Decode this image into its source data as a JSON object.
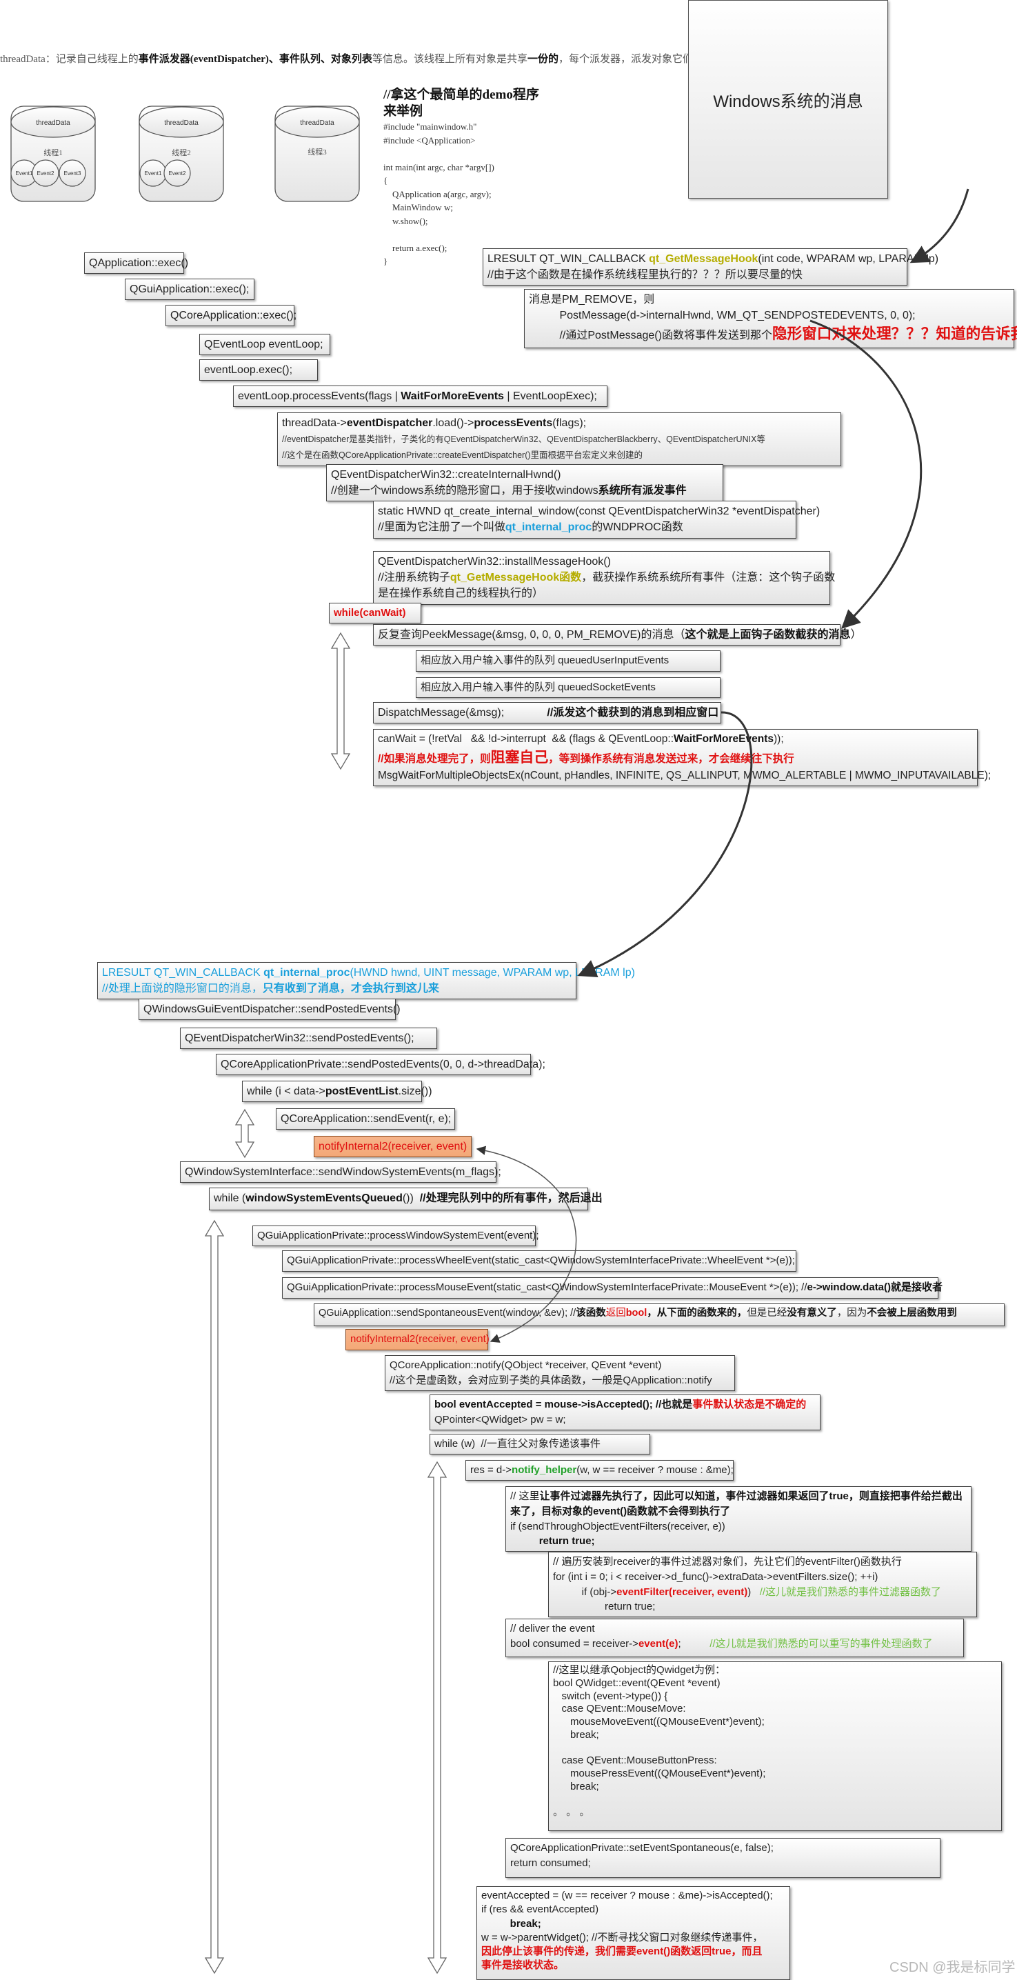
{
  "header": [
    [
      "threadData：记录自己线程上的",
      ""
    ],
    [
      "事件派发器(eventDispatcher)、事件队列、对象列表",
      "b"
    ],
    [
      "等信息。该线程上所有对象是共享",
      ""
    ],
    [
      "一份的",
      "b"
    ],
    [
      "，每个派发器，派发对象它们都有它的指针",
      ""
    ]
  ],
  "threads": [
    {
      "label": "threadData",
      "name": "线程1",
      "events": [
        "Event1",
        "Event2",
        "Event3"
      ]
    },
    {
      "label": "threadData",
      "name": "线程2",
      "events": [
        "Event1",
        "Event2"
      ]
    },
    {
      "label": "threadData",
      "name": "线程3",
      "events": []
    }
  ],
  "demo": {
    "title": "//拿这个最简单的demo程序来举例",
    "code": "#include \"mainwindow.h\"\n#include <QApplication>\n\nint main(int argc, char *argv[])\n{\n    QApplication a(argc, argv);\n    MainWindow w;\n    w.show();\n\n    return a.exec();\n}"
  },
  "windows_box": "Windows系统的消息",
  "boxes": [
    {
      "id": "get-message-hook",
      "lines": [
        [
          [
            "LRESULT QT_WIN_CALLBACK ",
            ""
          ],
          [
            "qt_GetMessageHook",
            "olive"
          ],
          [
            "(int code, WPARAM wp, LPARAM lp)",
            ""
          ]
        ],
        [
          [
            "//由于这个函数是在操作系统线程里执行的？？？所以要尽量的快",
            ""
          ]
        ]
      ]
    },
    {
      "id": "pm-remove",
      "lines": [
        [
          [
            "消息是PM_REMOVE，则",
            ""
          ]
        ],
        [
          [
            "          PostMessage(d->internalHwnd, WM_QT_SENDPOSTEDEVENTS, 0, 0);",
            ""
          ]
        ],
        [
          [
            "          //通过PostMessage()函数将事件发送到那个",
            ""
          ],
          [
            "隐形窗口对来处理？？？知道的告诉我",
            "bigred"
          ]
        ]
      ]
    },
    {
      "id": "qapplication-exec",
      "lines": [
        [
          [
            "QApplication::exec()",
            ""
          ]
        ]
      ]
    },
    {
      "id": "qguiapplication-exec",
      "lines": [
        [
          [
            "QGuiApplication::exec();",
            ""
          ]
        ]
      ]
    },
    {
      "id": "qcoreapplication-exec",
      "lines": [
        [
          [
            "QCoreApplication::exec();",
            ""
          ]
        ]
      ]
    },
    {
      "id": "qeventloop-decl",
      "lines": [
        [
          [
            "QEventLoop eventLoop;",
            ""
          ]
        ]
      ]
    },
    {
      "id": "eventloop-exec",
      "lines": [
        [
          [
            "eventLoop.exec();",
            ""
          ]
        ]
      ]
    },
    {
      "id": "process-events",
      "lines": [
        [
          [
            "eventLoop.processEvents(flags | ",
            ""
          ],
          [
            "WaitForMoreEvents",
            "b"
          ],
          [
            " | EventLoopExec);",
            ""
          ]
        ]
      ]
    },
    {
      "id": "dispatcher-process-events",
      "lines": [
        [
          [
            "threadData->",
            ""
          ],
          [
            "eventDispatcher",
            "b"
          ],
          [
            ".load()->",
            ""
          ],
          [
            "processEvents",
            "b"
          ],
          [
            "(flags);",
            ""
          ]
        ],
        [
          [
            "//eventDispatcher是基类指针，子类化的有QEventDispatcherWin32、QEventDispatcherBlackberry、QEventDispatcherUNIX等",
            "sm"
          ]
        ],
        [
          [
            "//这个是在函数QCoreApplicationPrivate::createEventDispatcher()里面根据平台宏定义来创建的",
            "sm"
          ]
        ]
      ]
    },
    {
      "id": "create-internal-hwnd",
      "lines": [
        [
          [
            "QEventDispatcherWin32::createInternalHwnd()",
            ""
          ]
        ],
        [
          [
            "//创建一个windows系统的隐形窗口，用于接收windows",
            ""
          ],
          [
            "系统所有派发事件",
            "b"
          ]
        ]
      ]
    },
    {
      "id": "create-internal-window",
      "lines": [
        [
          [
            "static HWND qt_create_internal_window(const QEventDispatcherWin32 *eventDispatcher)",
            ""
          ]
        ],
        [
          [
            "//里面为它注册了一个叫做",
            ""
          ],
          [
            "qt_internal_proc",
            "cyanb"
          ],
          [
            "的WNDPROC函数",
            ""
          ]
        ]
      ]
    },
    {
      "id": "install-message-hook",
      "lines": [
        [
          [
            "QEventDispatcherWin32::installMessageHook()",
            ""
          ]
        ],
        [
          [
            "//注册系统钩子",
            ""
          ],
          [
            "qt_GetMessageHook函数",
            "olive"
          ],
          [
            "，截获操作系统系统所有事件（注意：这个钩子函数",
            ""
          ]
        ],
        [
          [
            "是在操作系统自己的线程执行的）",
            ""
          ]
        ]
      ]
    },
    {
      "id": "while-canwait",
      "lines": [
        [
          [
            "while(canWait)",
            "redb"
          ]
        ]
      ]
    },
    {
      "id": "peek-message",
      "lines": [
        [
          [
            "反复查询PeekMessage(&msg, 0, 0, 0, PM_REMOVE)的消息（",
            ""
          ],
          [
            "这个就是上面钩子函数截获的消息",
            "b"
          ],
          [
            "）",
            ""
          ]
        ]
      ]
    },
    {
      "id": "queued-user-input",
      "lines": [
        [
          [
            "相应放入用户输入事件的队列 queuedUserInputEvents",
            ""
          ]
        ]
      ]
    },
    {
      "id": "queued-socket",
      "lines": [
        [
          [
            "相应放入用户输入事件的队列 queuedSocketEvents",
            ""
          ]
        ]
      ]
    },
    {
      "id": "dispatch-message",
      "lines": [
        [
          [
            "DispatchMessage(&msg);              ",
            ""
          ],
          [
            "//派发这个截获到的消息到相应窗口",
            "b"
          ]
        ]
      ]
    },
    {
      "id": "can-wait",
      "lines": [
        [
          [
            "canWait = (!retVal   && !d->interrupt  && (flags & QEventLoop::",
            ""
          ],
          [
            "WaitForMoreEvents",
            "b"
          ],
          [
            "));",
            ""
          ]
        ],
        [
          [
            "//如果消息处理完了，则",
            "redb"
          ],
          [
            "阻塞自己",
            "bigred"
          ],
          [
            "，等到操作系统有消息发送过来，才会继续往下执行",
            "redb"
          ]
        ],
        [
          [
            "MsgWaitForMultipleObjectsEx(nCount, pHandles, INFINITE, QS_ALLINPUT, MWMO_ALERTABLE | MWMO_INPUTAVAILABLE);",
            ""
          ]
        ]
      ]
    },
    {
      "id": "internal-proc",
      "lines": [
        [
          [
            "LRESULT QT_WIN_CALLBACK ",
            "cyan"
          ],
          [
            "qt_internal_proc",
            "cyanb"
          ],
          [
            "(HWND hwnd, UINT message, WPARAM wp, LPARAM lp)",
            "cyan"
          ]
        ],
        [
          [
            "//处理上面说的隐形窗口的消息，",
            "cyan"
          ],
          [
            "只有收到了消息，才会执行到这儿来",
            "cyanb"
          ]
        ]
      ]
    },
    {
      "id": "gui-send-posted",
      "lines": [
        [
          [
            "QWindowsGuiEventDispatcher::sendPostedEvents()",
            ""
          ]
        ]
      ]
    },
    {
      "id": "win32-send-posted",
      "lines": [
        [
          [
            "QEventDispatcherWin32::sendPostedEvents();",
            ""
          ]
        ]
      ]
    },
    {
      "id": "core-send-posted",
      "lines": [
        [
          [
            "QCoreApplicationPrivate::sendPostedEvents(0, 0, d->threadData);",
            ""
          ]
        ]
      ]
    },
    {
      "id": "while-post-event-list",
      "lines": [
        [
          [
            "while (i < data->",
            ""
          ],
          [
            "postEventList",
            "b"
          ],
          [
            ".size())",
            ""
          ]
        ]
      ]
    },
    {
      "id": "send-event",
      "lines": [
        [
          [
            "QCoreApplication::sendEvent(r, e);",
            ""
          ]
        ]
      ]
    },
    {
      "id": "notify-internal2-a",
      "orange": true,
      "lines": [
        [
          [
            "notifyInternal2(receiver, event)",
            "red"
          ]
        ]
      ]
    },
    {
      "id": "send-window-system-events",
      "lines": [
        [
          [
            "QWindowSystemInterface::sendWindowSystemEvents(m_flags);",
            ""
          ]
        ]
      ]
    },
    {
      "id": "while-window-system-events",
      "lines": [
        [
          [
            "while (",
            ""
          ],
          [
            "windowSystemEventsQueued",
            "b"
          ],
          [
            "())  ",
            ""
          ],
          [
            "//处理完队列中的所有事件，然后退出",
            "b"
          ]
        ]
      ]
    },
    {
      "id": "process-window-system-event",
      "lines": [
        [
          [
            "QGuiApplicationPrivate::processWindowSystemEvent(event);",
            ""
          ]
        ]
      ]
    },
    {
      "id": "process-wheel-event",
      "lines": [
        [
          [
            "QGuiApplicationPrivate::processWheelEvent(static_cast<QWindowSystemInterfacePrivate::WheelEvent *>(e));",
            ""
          ]
        ]
      ]
    },
    {
      "id": "process-mouse-event",
      "lines": [
        [
          [
            "QGuiApplicationPrivate::processMouseEvent(static_cast<QWindowSystemInterfacePrivate::MouseEvent *>(e)); //",
            ""
          ],
          [
            "e->window.data()就是接收者",
            "b"
          ]
        ]
      ]
    },
    {
      "id": "send-spontaneous-event",
      "lines": [
        [
          [
            "QGuiApplication::sendSpontaneousEvent(window, &ev); //",
            ""
          ],
          [
            "该函数",
            "b"
          ],
          [
            "返回",
            "red"
          ],
          [
            "bool",
            "redb"
          ],
          [
            "，从下面的函数来的，",
            "b"
          ],
          [
            "但是已经",
            ""
          ],
          [
            "没有意义了",
            "b"
          ],
          [
            "，因为",
            ""
          ],
          [
            "不会被上层函数用到",
            "b"
          ]
        ]
      ]
    },
    {
      "id": "notify-internal2-b",
      "orange": true,
      "lines": [
        [
          [
            "notifyInternal2(receiver, event)",
            "red"
          ]
        ]
      ]
    },
    {
      "id": "core-notify",
      "lines": [
        [
          [
            "QCoreApplication::notify(QObject *receiver, QEvent *event)",
            ""
          ]
        ],
        [
          [
            "//这个是虚函数，会对应到子类的具体函数，一般是QApplication::notify",
            ""
          ]
        ]
      ]
    },
    {
      "id": "event-accepted-init",
      "lines": [
        [
          [
            "bool eventAccepted = mouse->isAccepted(); //也就是",
            "b"
          ],
          [
            "事件默认状态是不确定的",
            "redb"
          ]
        ],
        [
          [
            "QPointer<QWidget> pw = w;",
            ""
          ]
        ]
      ]
    },
    {
      "id": "while-w",
      "lines": [
        [
          [
            "while (w)  //一直往父对象传递该事件",
            ""
          ]
        ]
      ]
    },
    {
      "id": "notify-helper",
      "lines": [
        [
          [
            "res = d->",
            ""
          ],
          [
            "notify_helper",
            "greenb"
          ],
          [
            "(w, w == receiver ? mouse : &me);",
            ""
          ]
        ]
      ]
    },
    {
      "id": "event-filters-comment",
      "wrap": true,
      "lines": [
        [
          [
            "// 这里",
            ""
          ],
          [
            "让事件过滤器先执行了，因此可以知道，事件过滤器如果返回了true，则直接把事件给拦截出来了，目标对象的event()函数就不会得到执行了",
            "b"
          ]
        ],
        [
          [
            "if (sendThroughObjectEventFilters(receiver, e))",
            ""
          ]
        ],
        [
          [
            "          return true;",
            "b"
          ]
        ]
      ]
    },
    {
      "id": "event-filters-loop",
      "lines": [
        [
          [
            "// 遍历安装到receiver的事件过滤器对象们，先让它们的eventFilter()函数执行",
            ""
          ]
        ],
        [
          [
            "for (int i = 0; i < receiver->d_func()->extraData->eventFilters.size(); ++i)",
            ""
          ]
        ],
        [
          [
            "          if (obj->",
            ""
          ],
          [
            "eventFilter(receiver, event)",
            "redb"
          ],
          [
            ")   ",
            ""
          ],
          [
            "//这儿就是我们熟悉的事件过滤器函数了",
            "lgreen"
          ]
        ],
        [
          [
            "                  return true;",
            ""
          ]
        ]
      ]
    },
    {
      "id": "deliver-event",
      "lines": [
        [
          [
            "// deliver the event",
            ""
          ]
        ],
        [
          [
            "bool consumed = receiver->",
            ""
          ],
          [
            "event(e)",
            "redb"
          ],
          [
            ";          ",
            ""
          ],
          [
            "//这儿就是我们熟悉的可以重写的事件处理函数了",
            "lgreen"
          ]
        ]
      ]
    },
    {
      "id": "qwidget-event",
      "lines": [
        [
          [
            "//这里以继承Qobject的Qwidget为例：",
            ""
          ]
        ],
        [
          [
            "bool QWidget::event(QEvent *event)",
            ""
          ]
        ],
        [
          [
            "   switch (event->type()) {",
            ""
          ]
        ],
        [
          [
            "   case QEvent::MouseMove:",
            ""
          ]
        ],
        [
          [
            "      mouseMoveEvent((QMouseEvent*)event);",
            ""
          ]
        ],
        [
          [
            "      break;",
            ""
          ]
        ],
        [
          [
            "",
            ""
          ]
        ],
        [
          [
            "   case QEvent::MouseButtonPress:",
            ""
          ]
        ],
        [
          [
            "      mousePressEvent((QMouseEvent*)event);",
            ""
          ]
        ],
        [
          [
            "      break;",
            ""
          ]
        ],
        [
          [
            "",
            ""
          ]
        ],
        [
          [
            "。 。 。",
            "grey"
          ]
        ]
      ]
    },
    {
      "id": "set-event-spontaneous",
      "lines": [
        [
          [
            "QCoreApplicationPrivate::setEventSpontaneous(e, false);",
            ""
          ]
        ],
        [
          [
            "return consumed;",
            ""
          ]
        ]
      ]
    },
    {
      "id": "event-accepted-loop",
      "lines": [
        [
          [
            "eventAccepted = (w == receiver ? mouse : &me)->isAccepted();",
            ""
          ]
        ],
        [
          [
            "if (res && eventAccepted)",
            ""
          ]
        ],
        [
          [
            "          break;",
            "b"
          ]
        ],
        [
          [
            "w = w->parentWidget(); //不断寻找父窗口对象继续传递事件，",
            ""
          ]
        ],
        [
          [
            "因此停止该事件的传递，我们需要event()函数返回true，而且",
            "redb"
          ]
        ],
        [
          [
            "事件是接收状态。",
            "redb"
          ]
        ]
      ]
    }
  ],
  "watermark": "CSDN @我是标同学",
  "colors": {
    "red": "#e01010",
    "olive": "#b5ad00",
    "cyan": "#1a9fdb",
    "green": "#22a02a",
    "light_green": "#71c043",
    "orange_fill": "#f4ac7c"
  }
}
